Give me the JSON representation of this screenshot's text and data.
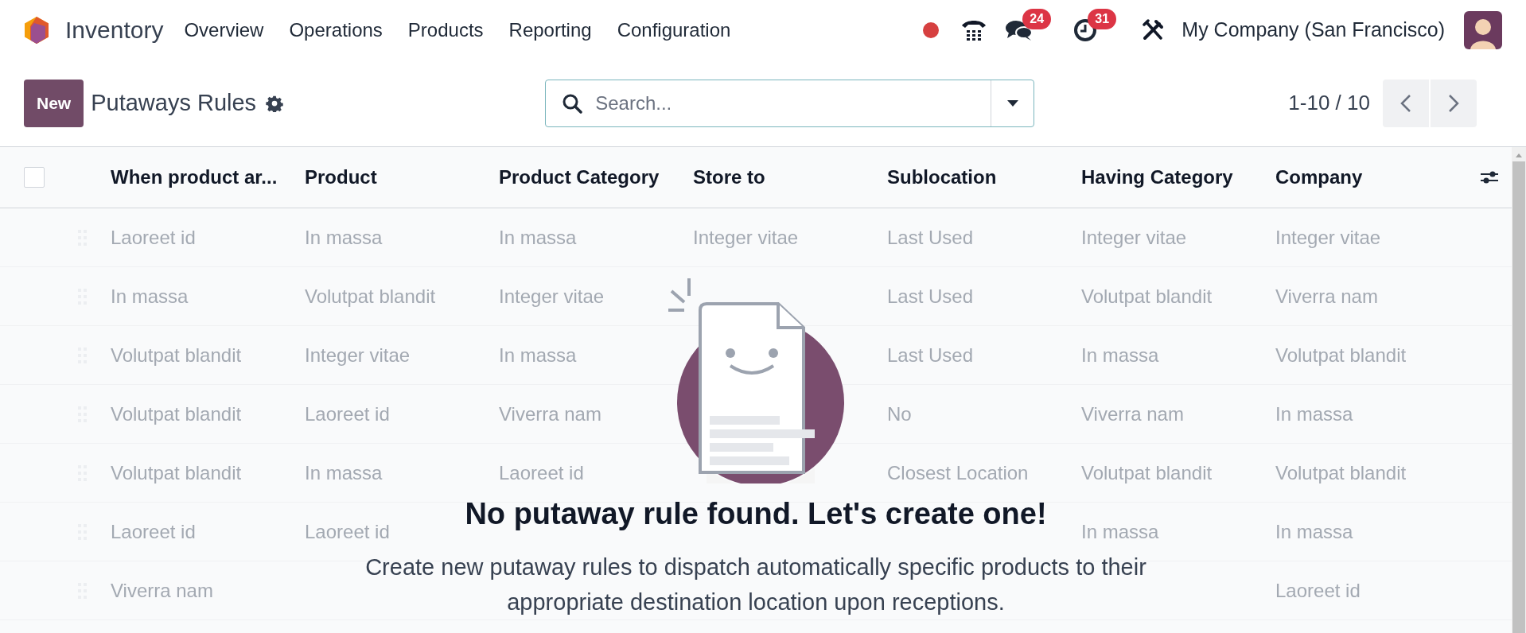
{
  "app": {
    "name": "Inventory"
  },
  "menu": [
    "Overview",
    "Operations",
    "Products",
    "Reporting",
    "Configuration"
  ],
  "systray": {
    "messages_badge": "24",
    "activities_badge": "31",
    "company": "My Company (San Francisco)"
  },
  "control_panel": {
    "new_button": "New",
    "title": "Putaways Rules",
    "search": {
      "placeholder": "Search..."
    },
    "pager": "1-10 / 10"
  },
  "table": {
    "select_all": {
      "checked": false
    },
    "columns": [
      "When product ar...",
      "Product",
      "Product Category",
      "Store to",
      "Sublocation",
      "Having Category",
      "Company"
    ],
    "rows": [
      {
        "when_product_arrives": "Laoreet id",
        "product": "In massa",
        "product_category": "In massa",
        "store_to": "Integer vitae",
        "sublocation": "Last Used",
        "having_category": "Integer vitae",
        "company": "Integer vitae"
      },
      {
        "when_product_arrives": "In massa",
        "product": "Volutpat blandit",
        "product_category": "Integer vitae",
        "sublocation": "Last Used",
        "having_category": "Volutpat blandit",
        "company": "Viverra nam"
      },
      {
        "when_product_arrives": "Volutpat blandit",
        "product": "Integer vitae",
        "product_category": "In massa",
        "sublocation": "Last Used",
        "having_category": "In massa",
        "company": "Volutpat blandit"
      },
      {
        "when_product_arrives": "Volutpat blandit",
        "product": "Laoreet id",
        "product_category": "Viverra nam",
        "sublocation": "No",
        "having_category": "Viverra nam",
        "company": "In massa"
      },
      {
        "when_product_arrives": "Volutpat blandit",
        "product": "In massa",
        "product_category": "Laoreet id",
        "sublocation": "Closest Location",
        "having_category": "Volutpat blandit",
        "company": "Volutpat blandit"
      },
      {
        "when_product_arrives": "Laoreet id",
        "product": "Laoreet id",
        "having_category": "In massa",
        "company": "In massa"
      },
      {
        "when_product_arrives": "Viverra nam",
        "company": "Laoreet id"
      }
    ]
  },
  "empty_state": {
    "title": "No putaway rule found. Let's create one!",
    "text": "Create new putaway rules to dispatch automatically specific products to their appropriate destination location upon receptions."
  }
}
